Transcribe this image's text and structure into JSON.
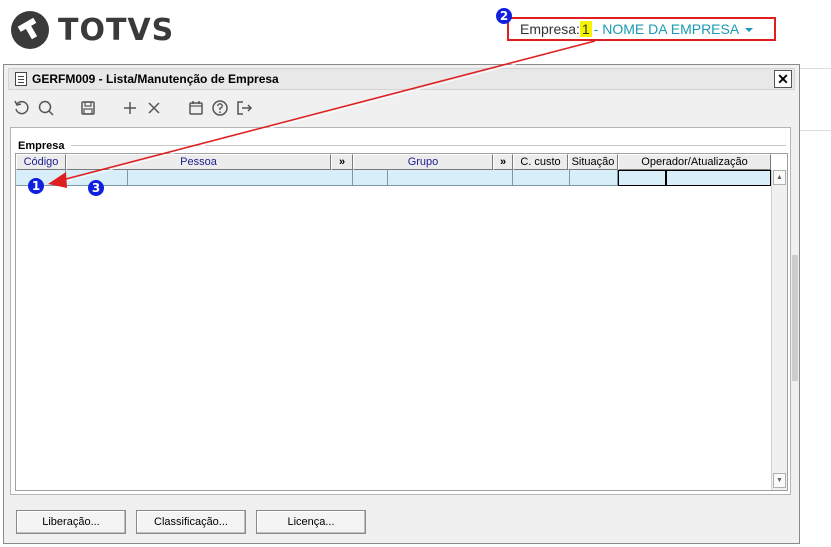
{
  "header": {
    "brand": "TOTVS",
    "empresa_label": "Empresa:",
    "empresa_number": "1",
    "empresa_name": "- NOME DA EMPRESA"
  },
  "window": {
    "title": "GERFM009 - Lista/Manutenção de Empresa",
    "close_label": "✕"
  },
  "toolbar": {
    "icons": [
      "undo-icon",
      "search-icon",
      "save-icon",
      "add-icon",
      "delete-icon",
      "calendar-icon",
      "help-icon",
      "exit-icon"
    ]
  },
  "group": {
    "title": "Empresa"
  },
  "grid": {
    "columns": [
      "Código",
      "Pessoa",
      "»",
      "Grupo",
      "»",
      "C. custo",
      "Situação",
      "Operador/Atualização"
    ]
  },
  "buttons": {
    "liberacao": "Liberação...",
    "classificacao": "Classificação...",
    "licenca": "Licença..."
  },
  "annotations": {
    "marker1": "1",
    "marker2": "2",
    "marker3": "3",
    "highlight_color": "#e02020",
    "marker_color": "#1020e0"
  }
}
